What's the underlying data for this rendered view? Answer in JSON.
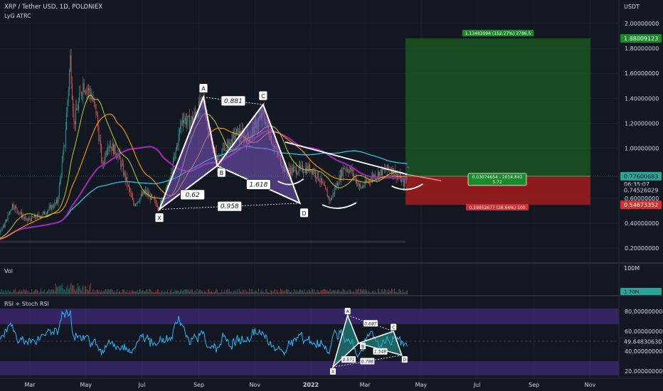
{
  "header": {
    "symbol": "XRP / Tether USD, 1D, POLONIEX",
    "indicator": "LyG ATRC",
    "currency": "USDT"
  },
  "price_axis": {
    "ticks": [
      "2.00000000",
      "1.80000000",
      "1.60000000",
      "1.40000000",
      "1.20000000",
      "1.00000000",
      "0.60000000",
      "0.40000000",
      "0.20000000"
    ],
    "ylim": [
      0.1,
      2.1
    ],
    "target_label": "1.88009123",
    "current_label": "0.77600683",
    "countdown": "06:35:07",
    "level_label": "0.74526029",
    "stop_label": "0.54673352"
  },
  "position": {
    "target_text": "1.13483094 (152.27%) 2786.5",
    "entry_text_1": "0.03074654 - 2014.842",
    "entry_text_2": "5.72",
    "stop_text": "0.19852677 (26.64%) 100",
    "target_price": 1.88009123,
    "entry_price": 0.77600683,
    "stop_price": 0.54673352,
    "profit_color": "#1b5e20",
    "loss_color": "#b71c1c"
  },
  "harmonic_main": {
    "points": [
      {
        "name": "X",
        "date": "2021-07-20",
        "price": 0.51
      },
      {
        "name": "A",
        "date": "2021-09-06",
        "price": 1.41
      },
      {
        "name": "B",
        "date": "2021-09-21",
        "price": 0.86
      },
      {
        "name": "C",
        "date": "2021-11-10",
        "price": 1.35
      },
      {
        "name": "D",
        "date": "2021-12-20",
        "price": 0.56
      }
    ],
    "ratios": [
      "0.881",
      "0.62",
      "1.618",
      "0.958"
    ],
    "fill": "#7e57c2"
  },
  "volume": {
    "title": "Vol",
    "scale_label": "100M",
    "last_label": "1.70M"
  },
  "rsi": {
    "title": "RSI + Stoch RSI",
    "ticks": [
      "80.00000000",
      "60.00000000",
      "40.00000000",
      "20.00000000"
    ],
    "last_label": "49.64830630",
    "ylim": [
      13,
      95
    ],
    "harmonic_points": [
      "X",
      "A",
      "B",
      "C",
      "D"
    ],
    "ratios": [
      "0.687",
      "0.571",
      "1.548",
      "0.786"
    ],
    "fill": "#26a69a"
  },
  "time_axis": {
    "ticks": [
      "Mar",
      "May",
      "Jul",
      "Sep",
      "Nov",
      "2022",
      "Mar",
      "May",
      "Jul",
      "Sep",
      "Nov"
    ]
  },
  "colors": {
    "background": "#131722",
    "candle_up": "#26a69a",
    "candle_down": "#ef5350",
    "ma_purple": "#9c27b0",
    "ma_cyan": "#26c6da",
    "ma_orange": "#ff9800",
    "ma_olive": "#c0ca33",
    "rsi_line": "#29b6f6",
    "rsi_band": "#5e35b1"
  }
}
